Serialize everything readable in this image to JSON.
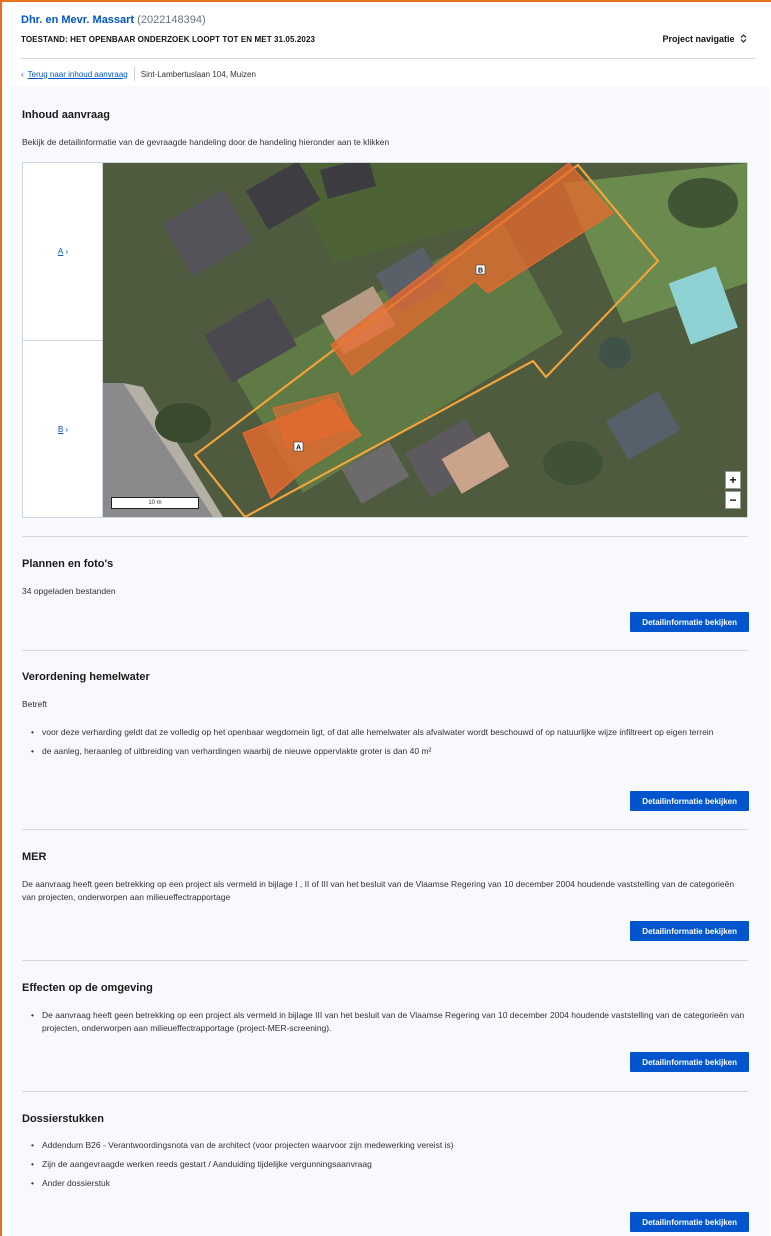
{
  "header": {
    "applicant_name": "Dhr. en Mevr. Massart",
    "dossier_number": "(2022148394)",
    "state": "TOESTAND: HET OPENBAAR ONDERZOEK LOOPT TOT EN MET 31.05.2023",
    "project_nav": "Project navigatie",
    "project_nav_icon": "updown-chevron-icon",
    "back_link": "Terug naar inhoud aanvraag",
    "address": "Sint-Lambertuslaan 104, Muizen"
  },
  "inhoud": {
    "title": "Inhoud aanvraag",
    "intro": "Bekijk de detailinformatie van de gevraagde handeling door de handeling hieronder aan te klikken",
    "tabs": [
      {
        "label": "A",
        "chevron": "›"
      },
      {
        "label": "B",
        "chevron": "›"
      }
    ],
    "map": {
      "marker_a": "A",
      "marker_b": "B",
      "scale_label": "10 m",
      "zoom_in": "+",
      "zoom_out": "−",
      "parcel_color": "#f2a33a",
      "building_color": "#e86a2e"
    }
  },
  "sections": {
    "plannen": {
      "title": "Plannen en foto's",
      "text": "34 opgeladen bestanden",
      "button": "Detailinformatie bekijken"
    },
    "hemelwater": {
      "title": "Verordening hemelwater",
      "sub": "Betreft",
      "items": [
        "voor deze verharding geldt dat ze volledig op het openbaar wegdomein ligt, of dat alle hemelwater als afvalwater wordt beschouwd of op natuurlijke wijze infiltreert op eigen terrein",
        "de aanleg, heraanleg of uitbreiding van verhardingen waarbij de nieuwe oppervlakte groter is dan 40 m²"
      ],
      "button": "Detailinformatie bekijken"
    },
    "mer": {
      "title": "MER",
      "text": "De aanvraag heeft geen betrekking op een project als vermeld in bijlage I , II of III van het besluit van de Vlaamse Regering van 10 december 2004 houdende vaststelling van de categorieën van projecten, onderworpen aan milieueffectrapportage",
      "button": "Detailinformatie bekijken"
    },
    "effecten": {
      "title": "Effecten op de omgeving",
      "items": [
        "De aanvraag heeft geen betrekking op een project als vermeld in bijlage III van het besluit van de Vlaamse Regering van 10 december 2004 houdende vaststelling van de categorieën van projecten, onderworpen aan milieueffectrapportage (project-MER-screening)."
      ],
      "button": "Detailinformatie bekijken"
    },
    "dossierstukken": {
      "title": "Dossierstukken",
      "items": [
        "Addendum B26 - Verantwoordingsnota van de architect (voor projecten waarvoor zijn medewerking vereist is)",
        "Zijn de aangevraagde werken reeds gestart / Aanduiding tijdelijke vergunningsaanvraag",
        "Ander dossierstuk"
      ],
      "button": "Detailinformatie bekijken"
    }
  },
  "colors": {
    "accent": "#0055cc",
    "frame": "#e8701e",
    "page_bg": "#f7f9fc"
  }
}
